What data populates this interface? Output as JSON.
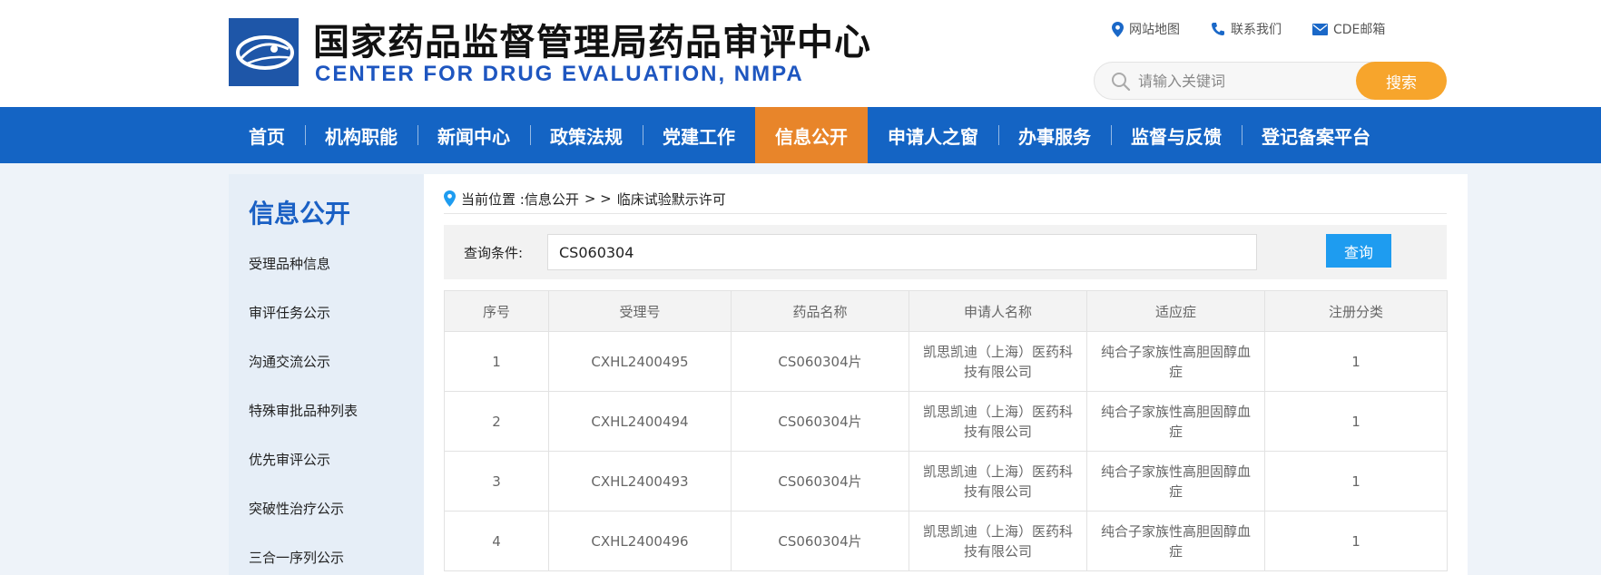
{
  "header": {
    "title": "国家药品监督管理局药品审评中心",
    "subtitle": "CENTER FOR DRUG EVALUATION, NMPA",
    "top_links": [
      {
        "label": "网站地图",
        "icon": "map-pin-icon"
      },
      {
        "label": "联系我们",
        "icon": "phone-icon"
      },
      {
        "label": "CDE邮箱",
        "icon": "mail-icon"
      }
    ],
    "search_placeholder": "请输入关键词",
    "search_button": "搜索"
  },
  "nav": {
    "items": [
      "首页",
      "机构职能",
      "新闻中心",
      "政策法规",
      "党建工作",
      "信息公开",
      "申请人之窗",
      "办事服务",
      "监督与反馈",
      "登记备案平台"
    ],
    "active_index": 5
  },
  "sidebar": {
    "title": "信息公开",
    "items": [
      "受理品种信息",
      "审评任务公示",
      "沟通交流公示",
      "特殊审批品种列表",
      "优先审评公示",
      "突破性治疗公示",
      "三合一序列公示"
    ]
  },
  "main": {
    "breadcrumb": {
      "prefix": "当前位置 : ",
      "section": "信息公开",
      "separator": "> >",
      "current": "临床试验默示许可"
    },
    "query": {
      "label": "查询条件:",
      "value": "CS060304",
      "button": "查询"
    },
    "table": {
      "columns": [
        "序号",
        "受理号",
        "药品名称",
        "申请人名称",
        "适应症",
        "注册分类"
      ],
      "rows": [
        [
          "1",
          "CXHL2400495",
          "CS060304片",
          "凯思凯迪（上海）医药科技有限公司",
          "纯合子家族性高胆固醇血症",
          "1"
        ],
        [
          "2",
          "CXHL2400494",
          "CS060304片",
          "凯思凯迪（上海）医药科技有限公司",
          "纯合子家族性高胆固醇血症",
          "1"
        ],
        [
          "3",
          "CXHL2400493",
          "CS060304片",
          "凯思凯迪（上海）医药科技有限公司",
          "纯合子家族性高胆固醇血症",
          "1"
        ],
        [
          "4",
          "CXHL2400496",
          "CS060304片",
          "凯思凯迪（上海）医药科技有限公司",
          "纯合子家族性高胆固醇血症",
          "1"
        ]
      ]
    }
  },
  "colors": {
    "nav_bg": "#1464c4",
    "nav_active": "#e8852a",
    "search_button": "#f7a52c",
    "query_button": "#1e9cf0",
    "sidebar_title": "#1a60c4"
  }
}
